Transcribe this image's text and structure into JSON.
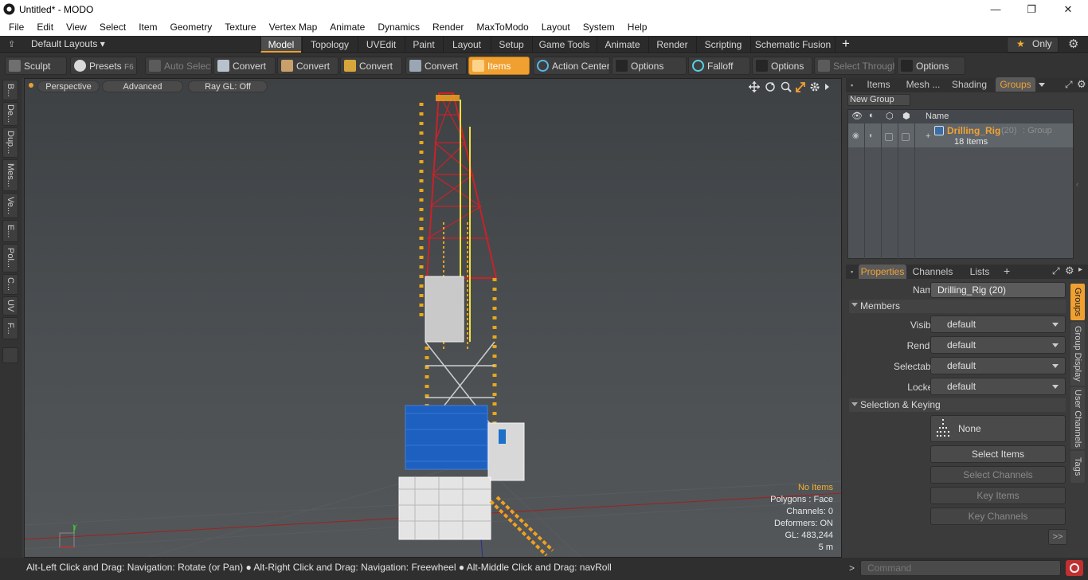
{
  "window": {
    "title": "Untitled* - MODO",
    "min": "—",
    "max": "❐",
    "close": "✕"
  },
  "menu": [
    "File",
    "Edit",
    "View",
    "Select",
    "Item",
    "Geometry",
    "Texture",
    "Vertex Map",
    "Animate",
    "Dynamics",
    "Render",
    "MaxToModo",
    "Layout",
    "System",
    "Help"
  ],
  "layoutbar": {
    "layouts": "Default Layouts ▾",
    "tabs": [
      "Model",
      "Topology",
      "UVEdit",
      "Paint",
      "Layout",
      "Setup",
      "Game Tools",
      "Animate",
      "Render",
      "Scripting",
      "Schematic Fusion"
    ],
    "plus": "+",
    "only": "Only",
    "star": "★",
    "gear": "⚙"
  },
  "toolbar": {
    "sculpt": "Sculpt",
    "presets": "Presets",
    "presets_key": "F6",
    "auto_select": "Auto Select",
    "convert1": "Convert",
    "convert2": "Convert",
    "convert3": "Convert",
    "convert4": "Convert",
    "items": "Items",
    "action_center": "Action Center",
    "options1": "Options",
    "falloff": "Falloff",
    "options2": "Options",
    "select_through": "Select Through",
    "options3": "Options"
  },
  "lefttabs": [
    "B...",
    "De...",
    "Dup...",
    "Mes...",
    "Ve...",
    "E...",
    "Pol...",
    "C...",
    "UV",
    "F..."
  ],
  "viewport": {
    "perspective": "Perspective",
    "advanced": "Advanced",
    "raygl": "Ray GL: Off",
    "axis_y": "Y",
    "info": {
      "items": "No Items",
      "polygons": "Polygons : Face",
      "channels": "Channels: 0",
      "deformers": "Deformers: ON",
      "gl": "GL: 483,244",
      "scale": "5 m"
    }
  },
  "status": "Alt-Left Click and Drag: Navigation: Rotate (or Pan) ● Alt-Right Click and Drag: Navigation: Freewheel ● Alt-Middle Click and Drag: navRoll",
  "command": {
    "placeholder": "Command",
    "prompt": ">"
  },
  "groups": {
    "tabs": [
      "Items",
      "Mesh ...",
      "Shading",
      "Groups"
    ],
    "new_group": "New Group",
    "col_name": "Name",
    "row": {
      "name": "Drilling_Rig",
      "count": "(20)",
      "type": ": Group",
      "sub": "18 Items"
    }
  },
  "props": {
    "tabs": [
      "Properties",
      "Channels",
      "Lists"
    ],
    "plus": "+",
    "name_label": "Name",
    "name_value": "Drilling_Rig (20)",
    "members": "Members",
    "visible_label": "Visible",
    "visible": "default",
    "render_label": "Render",
    "render": "default",
    "selectable_label": "Selectable",
    "selectable": "default",
    "locked_label": "Locked",
    "locked": "default",
    "sel_keying": "Selection & Keying",
    "none": "None",
    "select_items": "Select Items",
    "select_channels": "Select Channels",
    "key_items": "Key Items",
    "key_channels": "Key Channels",
    "more": ">>",
    "side_tabs": [
      "Groups",
      "Group Display",
      "User Channels",
      "Tags"
    ]
  }
}
